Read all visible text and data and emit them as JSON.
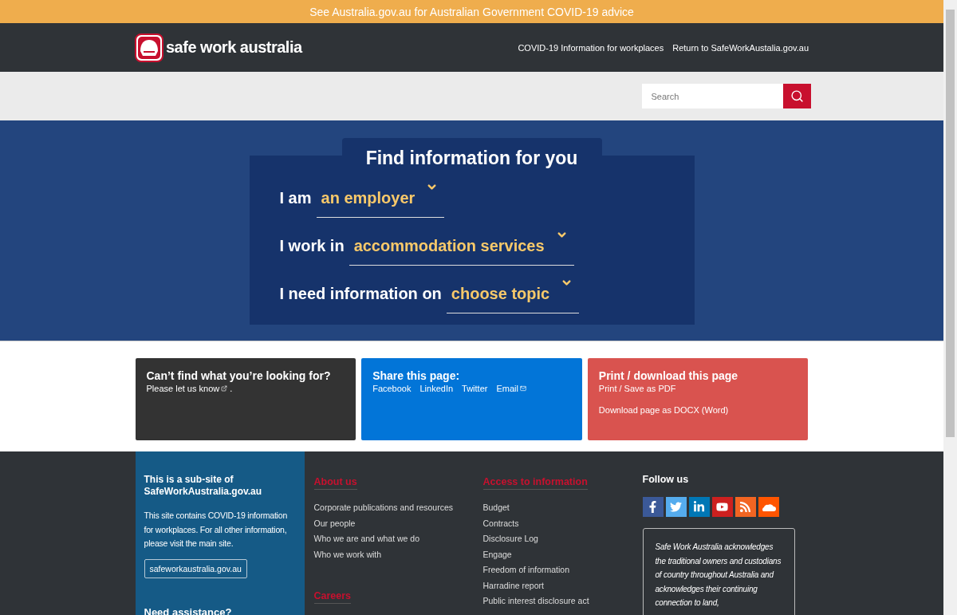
{
  "alert_banner": {
    "text": "See Australia.gov.au for Australian Government COVID-19 advice"
  },
  "header": {
    "logo_text": "safe work australia",
    "links": [
      "COVID-19 Information for workplaces",
      "Return to SafeWorkAustalia.gov.au"
    ]
  },
  "search": {
    "placeholder": "Search"
  },
  "finder": {
    "title": "Find information for you",
    "rows": [
      {
        "label": "I am",
        "value": "an employer"
      },
      {
        "label": "I work in",
        "value": "accommodation services"
      },
      {
        "label": "I need information on",
        "value": "choose topic"
      }
    ]
  },
  "cards": [
    {
      "kind": "feedback",
      "title": "Can’t find what you’re looking for?",
      "link": "Please let us know",
      "suffix": "."
    },
    {
      "kind": "share",
      "title": "Share this page:",
      "links": [
        "Facebook",
        "LinkedIn",
        "Twitter",
        "Email"
      ]
    },
    {
      "kind": "print",
      "title": "Print / download this page",
      "links": [
        "Print / Save as PDF",
        "Download page as DOCX (Word)"
      ]
    }
  ],
  "footer": {
    "subsite": {
      "title": "This is a sub-site of SafeWorkAustralia.gov.au",
      "text": "This site contains COVID-19 information for workplaces. For all other information, please visit the main site.",
      "button": "safeworkaustralia.gov.au",
      "assistance": "Need assistance?"
    },
    "columns": [
      {
        "sections": [
          {
            "heading": "About us",
            "links": [
              "Corporate publications and resources",
              "Our people",
              "Who we are and what we do",
              "Who we work with"
            ]
          },
          {
            "heading": "Careers"
          }
        ]
      },
      {
        "sections": [
          {
            "heading": "Access to information",
            "links": [
              "Budget",
              "Contracts",
              "Disclosure Log",
              "Engage",
              "Freedom of information",
              "Harradine report",
              "Public interest disclosure act"
            ]
          }
        ]
      }
    ],
    "follow": {
      "title": "Follow us",
      "icons": [
        {
          "kind": "facebook",
          "color": "#3b5998"
        },
        {
          "kind": "twitter",
          "color": "#55acee"
        },
        {
          "kind": "linkedin",
          "color": "#0077b5"
        },
        {
          "kind": "youtube",
          "color": "#cd201f"
        },
        {
          "kind": "rss",
          "color": "#f26522"
        },
        {
          "kind": "soundcloud",
          "color": "#ff5500"
        }
      ],
      "acknowledgement": "Safe Work Australia acknowledges the traditional owners and custodians of country throughout Australia and acknowledges their continuing connection to land,"
    }
  }
}
